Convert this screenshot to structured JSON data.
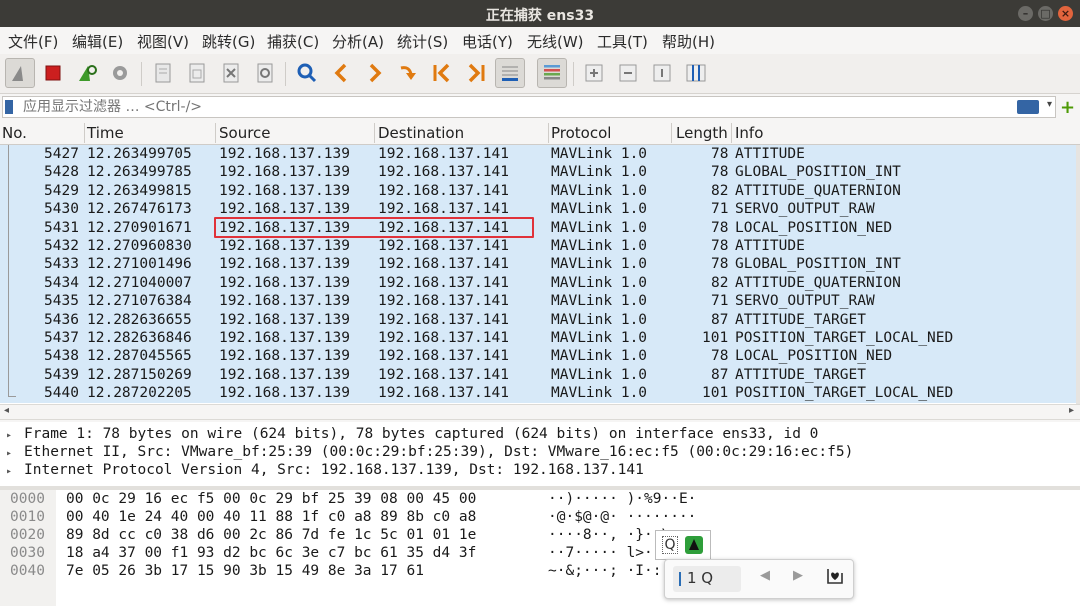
{
  "window": {
    "title": "正在捕获 ens33"
  },
  "menu": [
    "文件(F)",
    "编辑(E)",
    "视图(V)",
    "跳转(G)",
    "捕获(C)",
    "分析(A)",
    "统计(S)",
    "电话(Y)",
    "无线(W)",
    "工具(T)",
    "帮助(H)"
  ],
  "filter": {
    "placeholder": "应用显示过滤器 … <Ctrl-/>"
  },
  "columns": {
    "no": "No.",
    "time": "Time",
    "source": "Source",
    "destination": "Destination",
    "protocol": "Protocol",
    "length": "Length",
    "info": "Info"
  },
  "packets": [
    {
      "no": "5427",
      "time": "12.263499705",
      "src": "192.168.137.139",
      "dst": "192.168.137.141",
      "proto": "MAVLink 1.0",
      "len": "78",
      "info": "ATTITUDE"
    },
    {
      "no": "5428",
      "time": "12.263499785",
      "src": "192.168.137.139",
      "dst": "192.168.137.141",
      "proto": "MAVLink 1.0",
      "len": "78",
      "info": "GLOBAL_POSITION_INT"
    },
    {
      "no": "5429",
      "time": "12.263499815",
      "src": "192.168.137.139",
      "dst": "192.168.137.141",
      "proto": "MAVLink 1.0",
      "len": "82",
      "info": "ATTITUDE_QUATERNION"
    },
    {
      "no": "5430",
      "time": "12.267476173",
      "src": "192.168.137.139",
      "dst": "192.168.137.141",
      "proto": "MAVLink 1.0",
      "len": "71",
      "info": "SERVO_OUTPUT_RAW"
    },
    {
      "no": "5431",
      "time": "12.270901671",
      "src": "192.168.137.139",
      "dst": "192.168.137.141",
      "proto": "MAVLink 1.0",
      "len": "78",
      "info": "LOCAL_POSITION_NED"
    },
    {
      "no": "5432",
      "time": "12.270960830",
      "src": "192.168.137.139",
      "dst": "192.168.137.141",
      "proto": "MAVLink 1.0",
      "len": "78",
      "info": "ATTITUDE"
    },
    {
      "no": "5433",
      "time": "12.271001496",
      "src": "192.168.137.139",
      "dst": "192.168.137.141",
      "proto": "MAVLink 1.0",
      "len": "78",
      "info": "GLOBAL_POSITION_INT"
    },
    {
      "no": "5434",
      "time": "12.271040007",
      "src": "192.168.137.139",
      "dst": "192.168.137.141",
      "proto": "MAVLink 1.0",
      "len": "82",
      "info": "ATTITUDE_QUATERNION"
    },
    {
      "no": "5435",
      "time": "12.271076384",
      "src": "192.168.137.139",
      "dst": "192.168.137.141",
      "proto": "MAVLink 1.0",
      "len": "71",
      "info": "SERVO_OUTPUT_RAW"
    },
    {
      "no": "5436",
      "time": "12.282636655",
      "src": "192.168.137.139",
      "dst": "192.168.137.141",
      "proto": "MAVLink 1.0",
      "len": "87",
      "info": "ATTITUDE_TARGET"
    },
    {
      "no": "5437",
      "time": "12.282636846",
      "src": "192.168.137.139",
      "dst": "192.168.137.141",
      "proto": "MAVLink 1.0",
      "len": "101",
      "info": "POSITION_TARGET_LOCAL_NED"
    },
    {
      "no": "5438",
      "time": "12.287045565",
      "src": "192.168.137.139",
      "dst": "192.168.137.141",
      "proto": "MAVLink 1.0",
      "len": "78",
      "info": "LOCAL_POSITION_NED"
    },
    {
      "no": "5439",
      "time": "12.287150269",
      "src": "192.168.137.139",
      "dst": "192.168.137.141",
      "proto": "MAVLink 1.0",
      "len": "87",
      "info": "ATTITUDE_TARGET"
    },
    {
      "no": "5440",
      "time": "12.287202205",
      "src": "192.168.137.139",
      "dst": "192.168.137.141",
      "proto": "MAVLink 1.0",
      "len": "101",
      "info": "POSITION_TARGET_LOCAL_NED"
    }
  ],
  "details": [
    "Frame 1: 78 bytes on wire (624 bits), 78 bytes captured (624 bits) on interface ens33, id 0",
    "Ethernet II, Src: VMware_bf:25:39 (00:0c:29:bf:25:39), Dst: VMware_16:ec:f5 (00:0c:29:16:ec:f5)",
    "Internet Protocol Version 4, Src: 192.168.137.139, Dst: 192.168.137.141"
  ],
  "bytes": [
    {
      "off": "0000",
      "hex": "00 0c 29 16 ec f5 00 0c  29 bf 25 39 08 00 45 00",
      "ascii": "··)····· )·%9··E·"
    },
    {
      "off": "0010",
      "hex": "00 40 1e 24 40 00 40 11  88 1f c0 a8 89 8b c0 a8",
      "ascii": "·@·$@·@· ········"
    },
    {
      "off": "0020",
      "hex": "89 8d cc c0 38 d6 00 2c  86 7d fe 1c 5c 01 01 1e",
      "ascii": "····8··, ·}··\\···"
    },
    {
      "off": "0030",
      "hex": "18 a4 37 00 f1 93 d2 bc  6c 3e c7 bc 61 35 d4 3f",
      "ascii": "··7····· l>··a5·?"
    },
    {
      "off": "0040",
      "hex": "7e 05 26 3b 17 15 90 3b  15 49 8e 3a 17 61",
      "ascii": "~·&;···; ·I·:·a"
    }
  ],
  "search_popup": {
    "count": "1 Q",
    "icon_letter": "Q"
  },
  "colors": {
    "row_bg": "#d7e9f8",
    "highlight": "#e0323a",
    "titlebar": "#3c3b37"
  }
}
